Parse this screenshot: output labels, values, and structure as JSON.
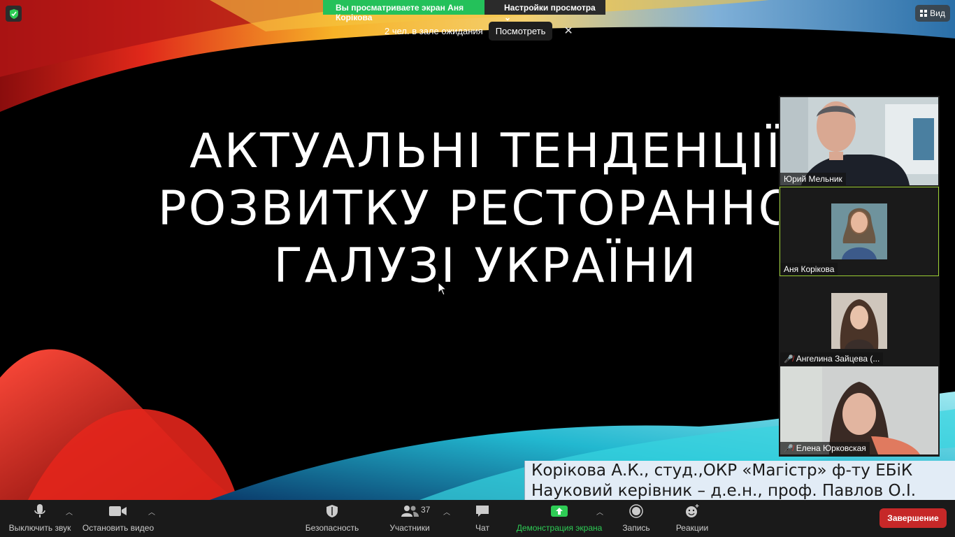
{
  "banner": {
    "viewing_text": "Вы просматриваете экран Аня Корікова",
    "view_settings_label": "Настройки просмотра"
  },
  "waiting_room": {
    "text": "2 чел. в зале ожидания",
    "view_button": "Посмотреть",
    "close_glyph": "✕"
  },
  "view_button": {
    "label": "Вид"
  },
  "slide": {
    "title_lines": [
      "АКТУАЛЬНІ ТЕНДЕНЦІЇ",
      "РОЗВИТКУ РЕСТОРАННОЇ",
      "ГАЛУЗІ УКРАЇНИ"
    ],
    "caption_lines": [
      "Корікова А.К., студ.,ОКР «Магістр» ф-ту ЕБіК",
      "Науковий керівник – д.е.н., проф. Павлов О.І."
    ]
  },
  "participants_tiles": [
    {
      "name": "Юрий Мельник",
      "muted": false,
      "active": false
    },
    {
      "name": "Аня Корікова",
      "muted": false,
      "active": true
    },
    {
      "name": "Ангелина Зайцева (...",
      "muted": true,
      "active": false
    },
    {
      "name": "Елена Юрковская",
      "muted": true,
      "active": false
    }
  ],
  "toolbar": {
    "mute_label": "Выключить звук",
    "video_label": "Остановить видео",
    "security_label": "Безопасность",
    "participants_label": "Участники",
    "participants_count": "37",
    "chat_label": "Чат",
    "share_label": "Демонстрация экрана",
    "record_label": "Запись",
    "reactions_label": "Реакции",
    "end_label": "Завершение"
  },
  "colors": {
    "banner_green": "#24c15a",
    "end_red": "#c62828",
    "share_green": "#2ecc55",
    "active_speaker_outline": "#9acd32"
  }
}
